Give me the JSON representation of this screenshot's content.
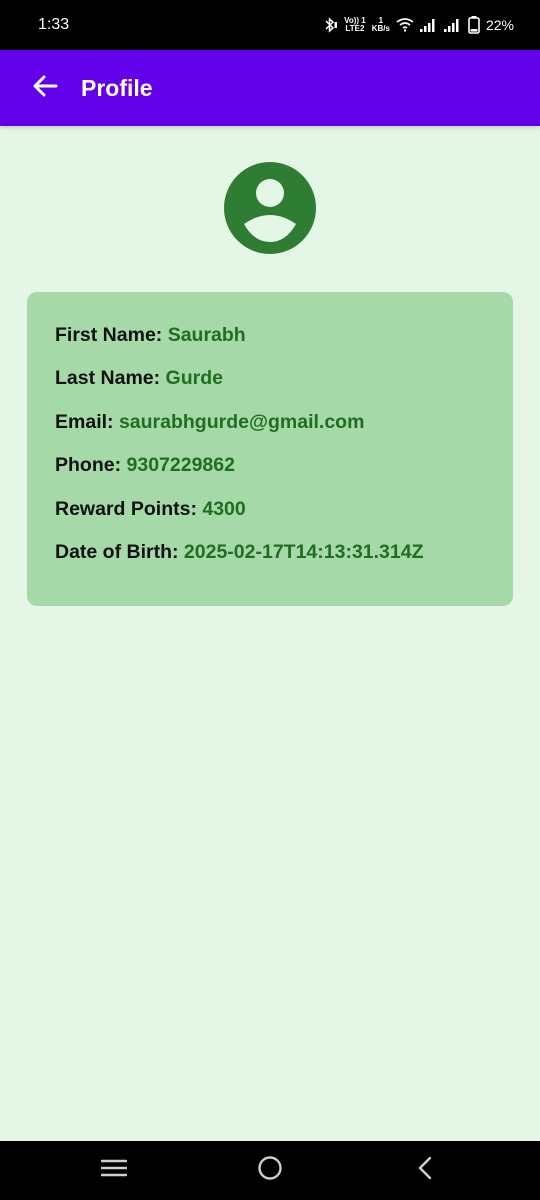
{
  "status_bar": {
    "time": "1:33",
    "volte_top": "Vo)) 1",
    "volte_bottom": "LTE2",
    "speed_top": "1",
    "speed_bottom": "KB/s",
    "battery": "22%",
    "icons": [
      "bluetooth-icon",
      "wifi-icon",
      "signal-icon",
      "signal-icon",
      "battery-icon"
    ]
  },
  "app_bar": {
    "title": "Profile",
    "background": "#6200ea",
    "back_icon": "arrow-back-icon"
  },
  "avatar": {
    "icon": "account-circle-icon",
    "color": "#2e7d32"
  },
  "profile": {
    "first_name_label": "First Name:",
    "first_name": "Saurabh",
    "last_name_label": "Last Name:",
    "last_name": "Gurde",
    "email_label": "Email:",
    "email": "saurabhgurde@gmail.com",
    "phone_label": "Phone:",
    "phone": "9307229862",
    "reward_points_label": "Reward Points:",
    "reward_points": "4300",
    "dob_label": "Date of Birth:",
    "dob": "2025-02-17T14:13:31.314Z"
  },
  "colors": {
    "page_background": "#e4f7e6",
    "card_background": "#a5d9a7",
    "value_text": "#1f6e21"
  },
  "nav_bar": {
    "icons": [
      "recent-apps-icon",
      "home-icon",
      "back-icon"
    ]
  }
}
